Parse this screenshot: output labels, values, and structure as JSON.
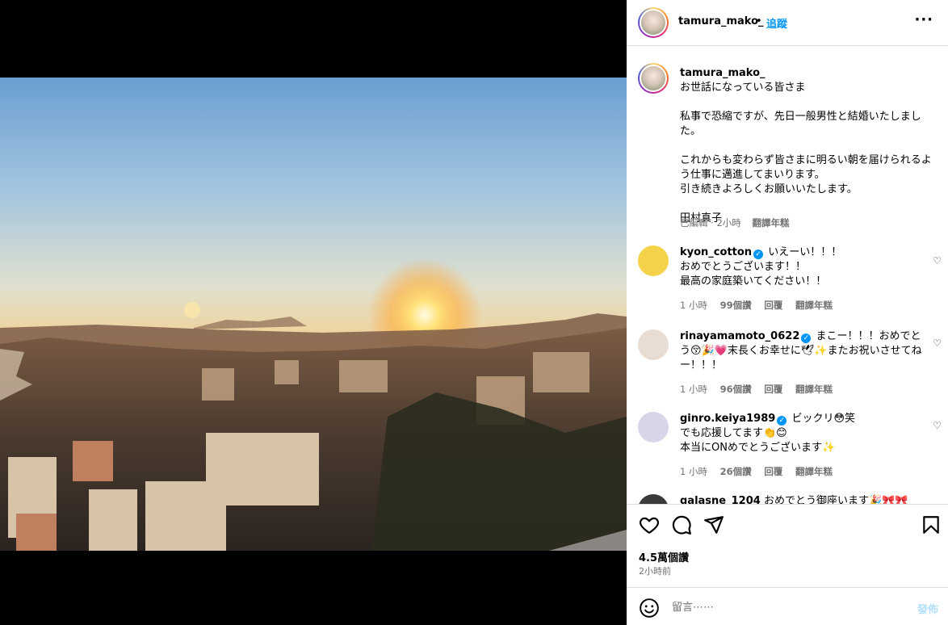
{
  "post": {
    "username": "tamura_mako_",
    "separator": "•",
    "follow_label": "追蹤",
    "more_label": "···"
  },
  "caption": {
    "username": "tamura_mako_",
    "line1": "お世話になっている皆さま",
    "para2": "私事で恐縮ですが、先日一般男性と結婚いたしました。",
    "para3": "これからも変わらず皆さまに明るい朝を届けられるよう仕事に邁進してまいります。\n引き続きよろしくお願いいたします。",
    "signature": "田村真子",
    "edited": "已編輯 · 2小時",
    "translate": "翻譯年糕"
  },
  "comments": [
    {
      "username": "kyon_cotton",
      "text": "いえーい！！！\nおめでとうございます！！\n最高の家庭築いてください！！",
      "time": "1 小時",
      "likes": "99個讚",
      "reply": "回覆",
      "translate": "翻譯年糕"
    },
    {
      "username": "rinayamamoto_0622",
      "text": "まこー！！！おめでとう😚🎉💗末長くお幸せに🕊✨またお祝いさせてねー！！！",
      "time": "1 小時",
      "likes": "96個讚",
      "reply": "回覆",
      "translate": "翻譯年糕"
    },
    {
      "username": "ginro.keiya1989",
      "text": "ビックリ😳笑\nでも応援してます👏😊\n本当にONめでとうございます✨",
      "time": "1 小時",
      "likes": "26個讚",
      "reply": "回覆",
      "translate": "翻譯年糕"
    },
    {
      "username": "galasne_1204",
      "text": "おめでとう御座います🎉🎀🎀"
    }
  ],
  "icons": {
    "like": "heart-icon",
    "comment": "comment-icon",
    "share": "send-icon",
    "save": "bookmark-icon",
    "emoji": "emoji-icon",
    "verified": "verified-badge"
  },
  "stats": {
    "likes": "4.5萬個讚",
    "posted": "2小時前"
  },
  "composer": {
    "placeholder": "留言⋯⋯",
    "post_label": "發佈"
  },
  "colors": {
    "link_blue": "#0095f6",
    "post_disabled": "#b2dffc",
    "muted": "#737373"
  }
}
